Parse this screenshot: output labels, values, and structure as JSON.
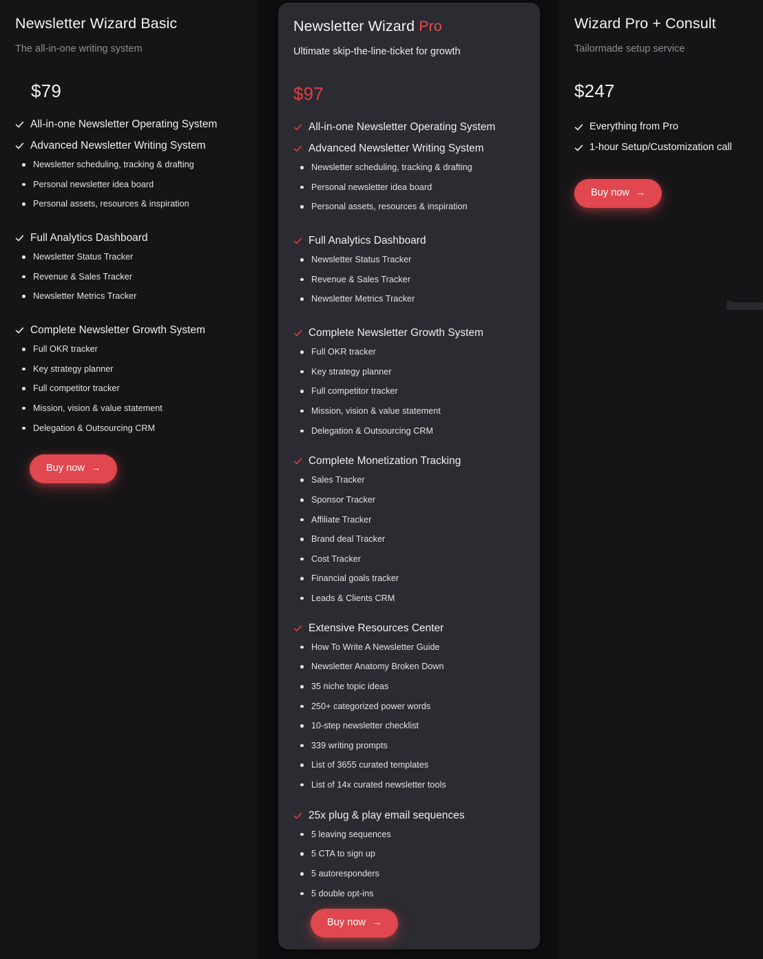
{
  "colors": {
    "page_bg": "#0e0e10",
    "card_bg": "#151517",
    "featured_card_bg": "#2b2b31",
    "accent_red": "#e0474e",
    "price_red": "#df3e46",
    "text_primary": "#f0f0f1",
    "text_muted": "#8e8e93"
  },
  "plans": [
    {
      "id": "basic",
      "title": "Newsletter Wizard Basic",
      "title_accent": "",
      "subtitle": "The all-in-one writing system",
      "price": "$79",
      "featured": false,
      "buy_label": "Buy now",
      "buy_arrow": "→",
      "groups": [
        {
          "title": "All-in-one Newsletter Operating System",
          "items": []
        },
        {
          "title": "Advanced Newsletter Writing System",
          "items": [
            "Newsletter scheduling, tracking & drafting",
            "Personal newsletter idea board",
            "Personal assets, resources & inspiration"
          ]
        },
        {
          "title": "Full Analytics Dashboard",
          "items": [
            "Newsletter Status Tracker",
            "Revenue & Sales Tracker",
            "Newsletter Metrics Tracker"
          ]
        },
        {
          "title": "Complete Newsletter Growth System",
          "items": [
            "Full OKR tracker",
            "Key strategy planner",
            "Full competitor tracker",
            "Mission, vision & value statement",
            "Delegation & Outsourcing CRM"
          ]
        }
      ]
    },
    {
      "id": "pro",
      "title": "Newsletter Wizard ",
      "title_accent": "Pro",
      "subtitle": "Ultimate skip-the-line-ticket for growth",
      "price": "$97",
      "featured": true,
      "buy_label": "Buy now",
      "buy_arrow": "→",
      "groups": [
        {
          "title": "All-in-one Newsletter Operating System",
          "items": []
        },
        {
          "title": "Advanced Newsletter Writing System",
          "items": [
            "Newsletter scheduling, tracking & drafting",
            "Personal newsletter idea board",
            "Personal assets, resources & inspiration"
          ]
        },
        {
          "title": "Full Analytics Dashboard",
          "items": [
            "Newsletter Status Tracker",
            "Revenue & Sales Tracker",
            "Newsletter Metrics Tracker"
          ]
        },
        {
          "title": "Complete Newsletter Growth System",
          "items": [
            "Full OKR tracker",
            "Key strategy planner",
            "Full competitor tracker",
            "Mission, vision & value statement",
            "Delegation & Outsourcing CRM"
          ]
        },
        {
          "title": "Complete Monetization Tracking",
          "items": [
            "Sales Tracker",
            "Sponsor Tracker",
            "Affiliate Tracker",
            "Brand deal Tracker",
            "Cost Tracker",
            "Financial goals tracker",
            "Leads & Clients CRM"
          ]
        },
        {
          "title": "Extensive Resources Center",
          "items": [
            "How To Write A Newsletter Guide",
            "Newsletter Anatomy Broken Down",
            "35 niche topic ideas",
            "250+ categorized power words",
            "10-step newsletter checklist",
            "339 writing prompts",
            "List of 3655 curated templates",
            "List of 14x curated newsletter tools"
          ]
        },
        {
          "title": "25x plug & play email sequences",
          "items": [
            "5 leaving sequences",
            "5 CTA to sign up",
            "5 autoresponders",
            "5 double opt-ins"
          ]
        }
      ]
    },
    {
      "id": "consult",
      "title": "Wizard Pro + Consult",
      "title_accent": "",
      "subtitle": "Tailormade setup service",
      "price": "$247",
      "featured": false,
      "buy_label": "Buy now",
      "buy_arrow": "→",
      "simple_rows": [
        "Everything from Pro",
        "1-hour Setup/Customization call"
      ],
      "groups": []
    }
  ]
}
